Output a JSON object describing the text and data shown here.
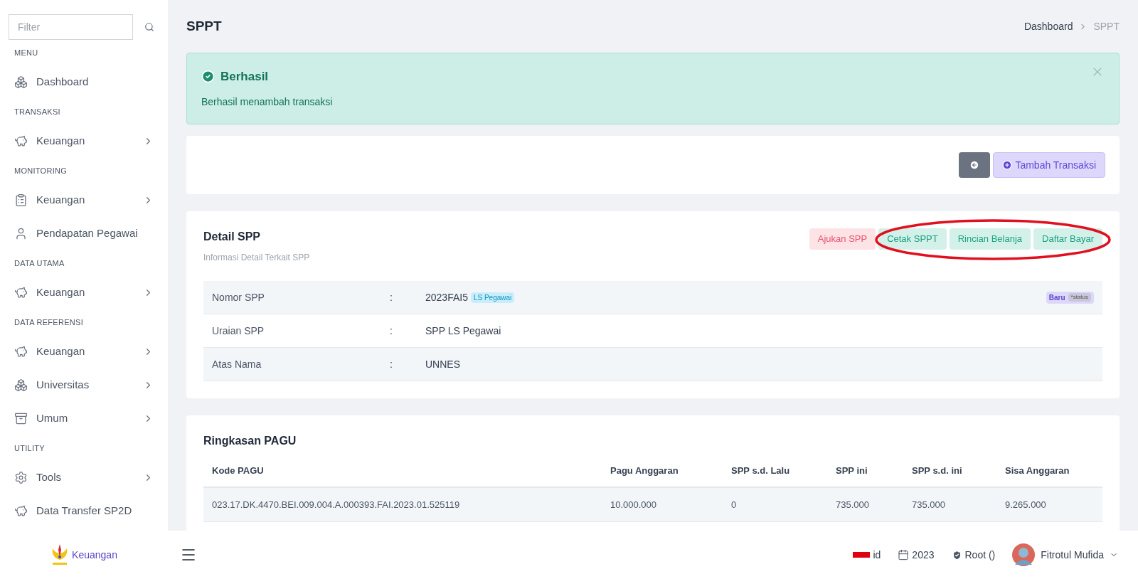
{
  "sidebar": {
    "filter": {
      "placeholder": "Filter"
    },
    "sections": [
      {
        "heading": "MENU",
        "items": [
          {
            "label": "Dashboard",
            "has_children": false
          }
        ]
      },
      {
        "heading": "TRANSAKSI",
        "items": [
          {
            "label": "Keuangan",
            "has_children": true
          }
        ]
      },
      {
        "heading": "MONITORING",
        "items": [
          {
            "label": "Keuangan",
            "has_children": true
          },
          {
            "label": "Pendapatan Pegawai",
            "has_children": false
          }
        ]
      },
      {
        "heading": "DATA UTAMA",
        "items": [
          {
            "label": "Keuangan",
            "has_children": true
          }
        ]
      },
      {
        "heading": "DATA REFERENSI",
        "items": [
          {
            "label": "Keuangan",
            "has_children": true
          },
          {
            "label": "Universitas",
            "has_children": true
          },
          {
            "label": "Umum",
            "has_children": true
          }
        ]
      },
      {
        "heading": "UTILITY",
        "items": [
          {
            "label": "Tools",
            "has_children": true
          },
          {
            "label": "Data Transfer SP2D",
            "has_children": false
          }
        ]
      }
    ]
  },
  "page": {
    "title": "SPPT",
    "breadcrumb": [
      "Dashboard",
      "SPPT"
    ]
  },
  "alert": {
    "title": "Berhasil",
    "message": "Berhasil menambah transaksi"
  },
  "toolbar": {
    "add_button": "Tambah Transaksi"
  },
  "detail": {
    "title": "Detail SPP",
    "subtitle": "Informasi Detail Terkait SPP",
    "highlight_ellipse": true,
    "actions": [
      {
        "label": "Ajukan SPP",
        "kind": "danger"
      },
      {
        "label": "Cetak SPPT",
        "kind": "success"
      },
      {
        "label": "Rincian Belanja",
        "kind": "success"
      },
      {
        "label": "Daftar Bayar",
        "kind": "success"
      }
    ],
    "rows": [
      {
        "label": "Nomor SPP",
        "sep": ":",
        "value": "2023FAI5",
        "tag": "LS Pegawai",
        "status": "Baru",
        "status_note": "*status"
      },
      {
        "label": "Uraian SPP",
        "sep": ":",
        "value": "SPP LS Pegawai"
      },
      {
        "label": "Atas Nama",
        "sep": ":",
        "value": "UNNES"
      }
    ]
  },
  "summary": {
    "title": "Ringkasan PAGU",
    "columns": [
      "Kode PAGU",
      "Pagu Anggaran",
      "SPP s.d. Lalu",
      "SPP ini",
      "SPP s.d. ini",
      "Sisa Anggaran"
    ],
    "rows": [
      [
        "023.17.DK.4470.BEI.009.004.A.000393.FAI.2023.01.525119",
        "10.000.000",
        "0",
        "735.000",
        "735.000",
        "9.265.000"
      ]
    ]
  },
  "footer": {
    "brand": "Keuangan",
    "language": "id",
    "year": "2023",
    "role": "Root ()",
    "user": "Fitrotul Mufida"
  }
}
